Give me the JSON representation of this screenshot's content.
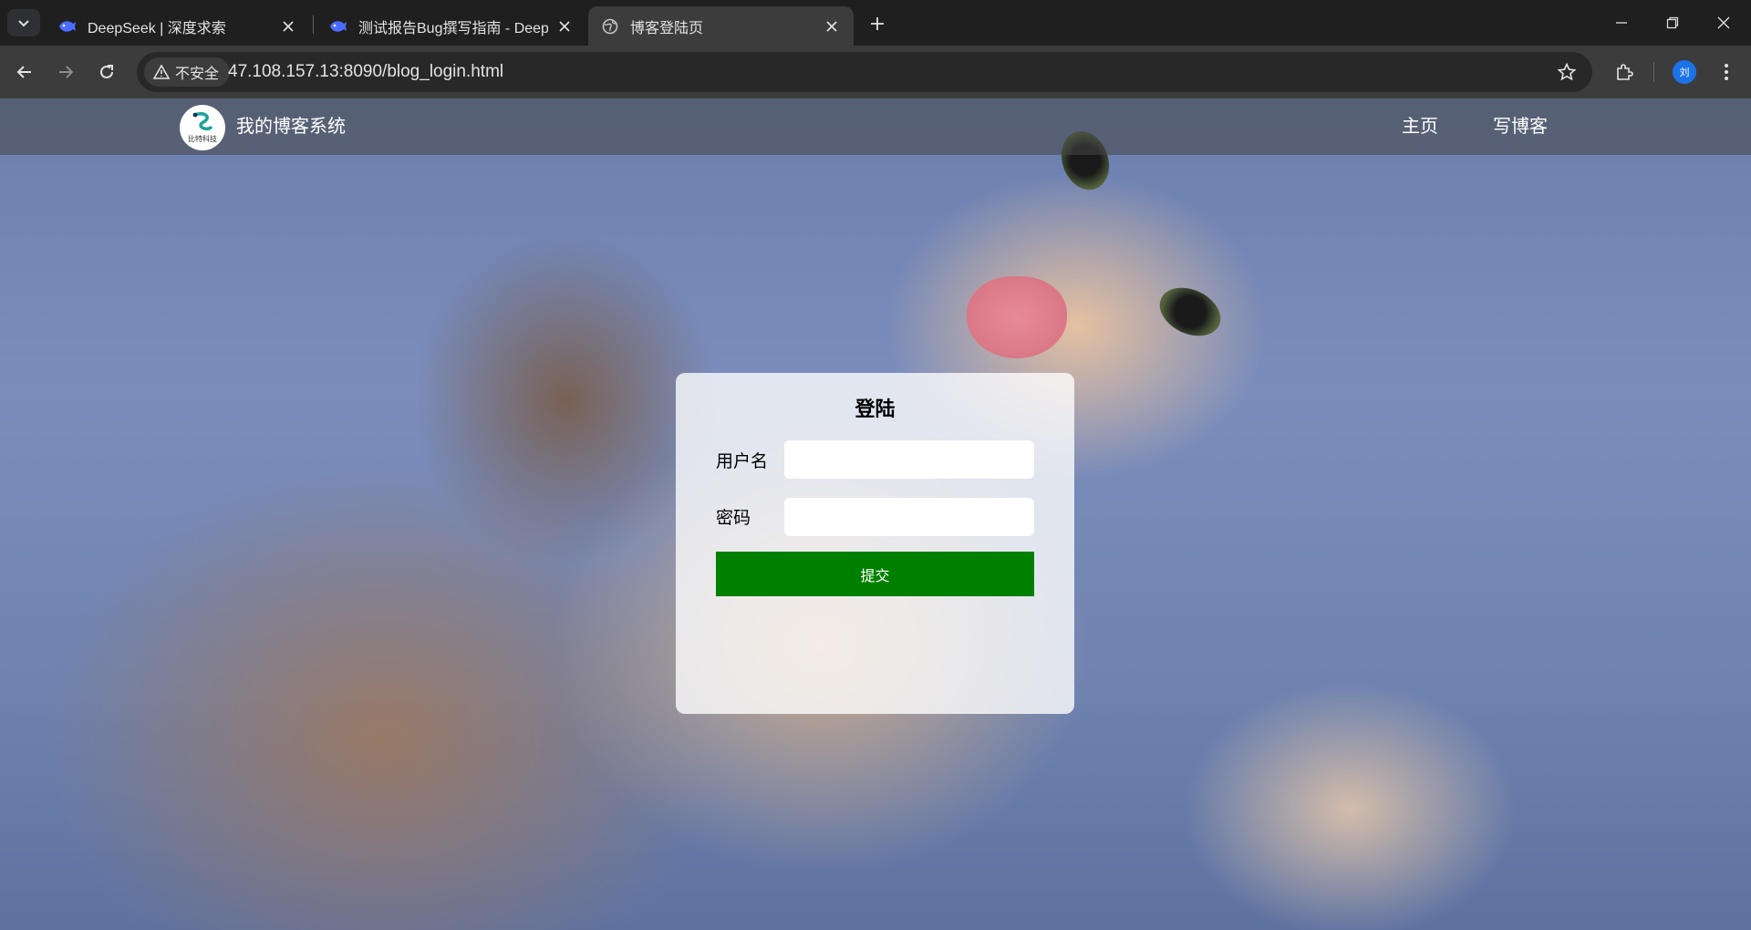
{
  "browser": {
    "tabs": [
      {
        "title": "DeepSeek | 深度求索",
        "favicon": "deepseek-whale-icon",
        "active": false
      },
      {
        "title": "测试报告Bug撰写指南 - DeepS",
        "favicon": "deepseek-whale-icon",
        "active": false
      },
      {
        "title": "博客登陆页",
        "favicon": "globe-icon",
        "active": true
      }
    ],
    "security_label": "不安全",
    "url": "47.108.157.13:8090/blog_login.html",
    "profile_initial": "刘",
    "colors": {
      "tabbar": "#1f1f1f",
      "toolbar": "#3c3c3c",
      "omnibox": "#282828",
      "accent": "#1a73e8"
    }
  },
  "site": {
    "logo_text": "比特科技",
    "title": "我的博客系统",
    "nav": [
      {
        "label": "主页"
      },
      {
        "label": "写博客"
      }
    ]
  },
  "login": {
    "title": "登陆",
    "username_label": "用户名",
    "username_value": "",
    "password_label": "密码",
    "password_value": "",
    "submit_label": "提交",
    "colors": {
      "submit": "#008000"
    }
  }
}
